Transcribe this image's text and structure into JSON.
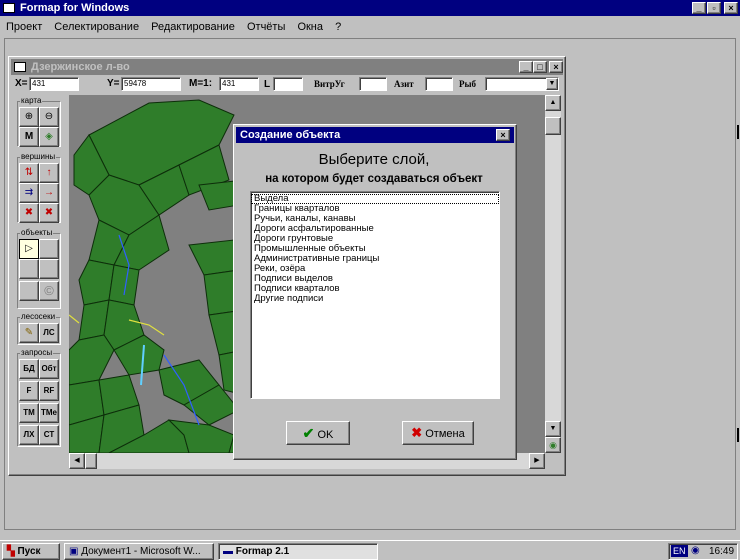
{
  "app": {
    "title": "Formap for Windows",
    "menu": [
      "Проект",
      "Селектирование",
      "Редактирование",
      "Отчёты",
      "Окна",
      "?"
    ]
  },
  "map_window": {
    "title": "Дзержинское л-во",
    "fields": {
      "x_label": "X=",
      "x_value": "431",
      "y_label": "Y=",
      "y_value": "59478",
      "m_label": "M=1:",
      "m_value": "431",
      "l_label": "L",
      "vitr_label": "ВитрУг",
      "azim_label": "Азит",
      "rib_label": "Рыб"
    },
    "toolbox": {
      "groups": [
        "карта",
        "вершины",
        "объекты",
        "лесосеки",
        "запросы"
      ],
      "text_buttons": [
        "М",
        "ЛС",
        "БД",
        "Обт",
        "F",
        "RF",
        "ТМ",
        "ТМе",
        "ЛХ",
        "СТ"
      ]
    }
  },
  "dialog": {
    "title": "Создание объекта",
    "heading": "Выберите слой,",
    "subheading": "на котором будет создаваться объект",
    "layers": [
      "Выдела",
      "Границы кварталов",
      "Ручьи, каналы, канавы",
      "Дороги асфальтированные",
      "Дороги грунтовые",
      "Промышленные объекты",
      "Административные границы",
      "Реки, озёра",
      "Подписи выделов",
      "Подписи кварталов",
      "Другие подписи"
    ],
    "ok_label": "OK",
    "cancel_label": "Отмена"
  },
  "taskbar": {
    "start_label": "Пуск",
    "tasks": [
      "Документ1 - Microsoft W...",
      "Formap 2.1"
    ],
    "lang": "EN",
    "clock": "16:49"
  },
  "colors": {
    "titlebar_active": "#000080",
    "map_green": "#2f7d2a",
    "map_background": "#808080"
  }
}
